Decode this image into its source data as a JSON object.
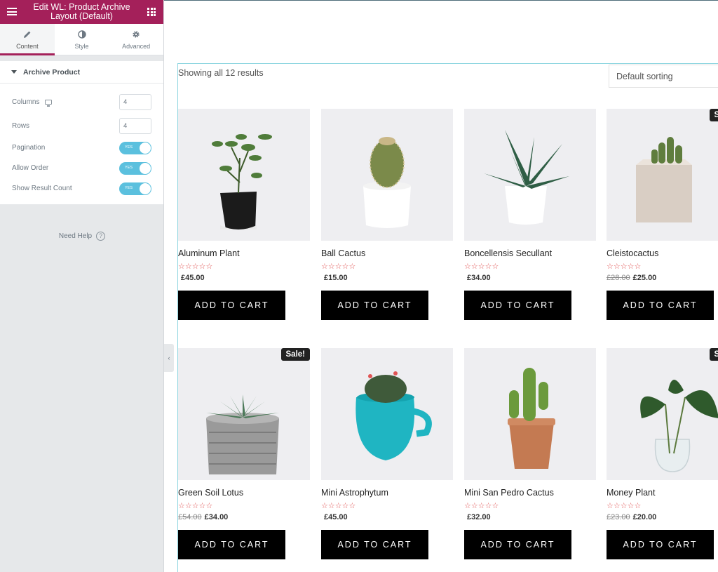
{
  "panel": {
    "title": "Edit WL: Product Archive Layout (Default)",
    "accent_color": "#a4205a",
    "tabs": [
      {
        "label": "Content",
        "icon": "pencil-icon"
      },
      {
        "label": "Style",
        "icon": "half-circle-icon"
      },
      {
        "label": "Advanced",
        "icon": "gear-icon"
      }
    ],
    "section_title": "Archive Product",
    "controls": {
      "columns": {
        "label": "Columns",
        "value": "4"
      },
      "rows": {
        "label": "Rows",
        "value": "4"
      },
      "pagination": {
        "label": "Pagination",
        "state": "YES"
      },
      "allow_order": {
        "label": "Allow Order",
        "state": "YES"
      },
      "show_result_count": {
        "label": "Show Result Count",
        "state": "YES"
      }
    },
    "help_label": "Need Help",
    "help_icon": "?"
  },
  "shop": {
    "result_count": "Showing all 12 results",
    "ordering_selected": "Default sorting",
    "sale_badge": "Sale!",
    "button_label": "ADD TO CART",
    "stars": "☆☆☆☆☆",
    "products": [
      {
        "name": "Aluminum Plant",
        "price": "£45.00",
        "old_price": "",
        "sale": false
      },
      {
        "name": "Ball Cactus",
        "price": "£15.00",
        "old_price": "",
        "sale": false
      },
      {
        "name": "Boncellensis Secullant",
        "price": "£34.00",
        "old_price": "",
        "sale": false
      },
      {
        "name": "Cleistocactus",
        "price": "£25.00",
        "old_price": "£28.00",
        "sale": true
      },
      {
        "name": "Green Soil Lotus",
        "price": "£34.00",
        "old_price": "£54.00",
        "sale": true
      },
      {
        "name": "Mini Astrophytum",
        "price": "£45.00",
        "old_price": "",
        "sale": false
      },
      {
        "name": "Mini San Pedro Cactus",
        "price": "£32.00",
        "old_price": "",
        "sale": false
      },
      {
        "name": "Money Plant",
        "price": "£20.00",
        "old_price": "£23.00",
        "sale": true
      }
    ]
  }
}
